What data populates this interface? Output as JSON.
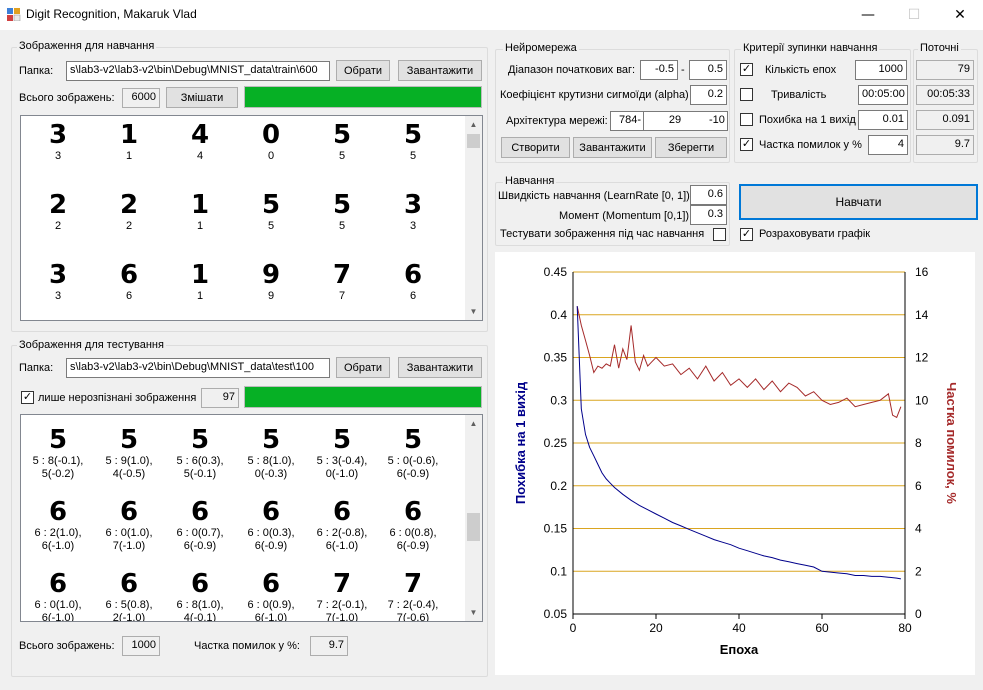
{
  "window": {
    "title": "Digit Recognition, Makaruk Vlad",
    "minimize": "—",
    "maximize": "☐",
    "close": "✕"
  },
  "train": {
    "group": "Зображення для навчання",
    "folder_label": "Папка:",
    "folder": "s\\lab3-v2\\lab3-v2\\bin\\Debug\\MNIST_data\\train\\600",
    "choose": "Обрати",
    "load": "Завантажити",
    "total_label": "Всього зображень:",
    "total": "6000",
    "shuffle": "Змішати",
    "progress": 1.0,
    "images": [
      {
        "d": "3",
        "l": "3"
      },
      {
        "d": "1",
        "l": "1"
      },
      {
        "d": "4",
        "l": "4"
      },
      {
        "d": "0",
        "l": "0"
      },
      {
        "d": "5",
        "l": "5"
      },
      {
        "d": "5",
        "l": "5"
      },
      {
        "d": "2",
        "l": "2"
      },
      {
        "d": "2",
        "l": "2"
      },
      {
        "d": "1",
        "l": "1"
      },
      {
        "d": "5",
        "l": "5"
      },
      {
        "d": "5",
        "l": "5"
      },
      {
        "d": "3",
        "l": "3"
      },
      {
        "d": "3",
        "l": "3"
      },
      {
        "d": "6",
        "l": "6"
      },
      {
        "d": "1",
        "l": "1"
      },
      {
        "d": "9",
        "l": "9"
      },
      {
        "d": "7",
        "l": "7"
      },
      {
        "d": "6",
        "l": "6"
      }
    ]
  },
  "test": {
    "group": "Зображення для тестування",
    "folder_label": "Папка:",
    "folder": "s\\lab3-v2\\lab3-v2\\bin\\Debug\\MNIST_data\\test\\100",
    "choose": "Обрати",
    "load": "Завантажити",
    "only_wrong_label": "лише нерозпізнані зображення",
    "only_wrong_checked": true,
    "wrong_count": "97",
    "progress": 1.0,
    "images": [
      {
        "d": "5",
        "l1": "5 : 8(-0.1),",
        "l2": "5(-0.2)"
      },
      {
        "d": "5",
        "l1": "5 : 9(1.0),",
        "l2": "4(-0.5)"
      },
      {
        "d": "5",
        "l1": "5 : 6(0.3),",
        "l2": "5(-0.1)"
      },
      {
        "d": "5",
        "l1": "5 : 8(1.0),",
        "l2": "0(-0.3)"
      },
      {
        "d": "5",
        "l1": "5 : 3(-0.4),",
        "l2": "0(-1.0)"
      },
      {
        "d": "5",
        "l1": "5 : 0(-0.6),",
        "l2": "6(-0.9)"
      },
      {
        "d": "6",
        "l1": "6 : 2(1.0),",
        "l2": "6(-1.0)"
      },
      {
        "d": "6",
        "l1": "6 : 0(1.0),",
        "l2": "7(-1.0)"
      },
      {
        "d": "6",
        "l1": "6 : 0(0.7),",
        "l2": "6(-0.9)"
      },
      {
        "d": "6",
        "l1": "6 : 0(0.3),",
        "l2": "6(-0.9)"
      },
      {
        "d": "6",
        "l1": "6 : 2(-0.8),",
        "l2": "6(-1.0)"
      },
      {
        "d": "6",
        "l1": "6 : 0(0.8),",
        "l2": "6(-0.9)"
      },
      {
        "d": "6",
        "l1": "6 : 0(1.0),",
        "l2": "6(-1.0)"
      },
      {
        "d": "6",
        "l1": "6 : 5(0.8),",
        "l2": "2(-1.0)"
      },
      {
        "d": "6",
        "l1": "6 : 8(1.0),",
        "l2": "4(-0.1)"
      },
      {
        "d": "6",
        "l1": "6 : 0(0.9),",
        "l2": "6(-1.0)"
      },
      {
        "d": "7",
        "l1": "7 : 2(-0.1),",
        "l2": "7(-1.0)"
      },
      {
        "d": "7",
        "l1": "7 : 2(-0.4),",
        "l2": "7(-0.6)"
      }
    ],
    "total_label": "Всього зображень:",
    "total": "1000",
    "error_label": "Частка помилок у %:",
    "error": "9.7"
  },
  "network": {
    "group": "Нейромережа",
    "weights_label": "Діапазон початкових ваг:",
    "w_min": "-0.5",
    "dash": "-",
    "w_max": "0.5",
    "alpha_label": "Коефіцієнт крутизни сигмоїди (alpha)",
    "alpha": "0.2",
    "arch_label": "Архітектура мережі:",
    "arch_in": "784-",
    "arch_hidden": "29",
    "arch_out": "-10",
    "create": "Створити",
    "load": "Завантажити",
    "save": "Зберегти"
  },
  "training": {
    "group": "Навчання",
    "lr_label": "Швидкість навчання (LearnRate [0, 1])",
    "lr": "0.6",
    "momentum_label": "Момент (Momentum [0,1])",
    "momentum": "0.3",
    "test_during_label": "Тестувати зображення під час навчання",
    "test_during_checked": false,
    "train_button": "Навчати",
    "calc_graph_label": "Розраховувати графік",
    "calc_graph_checked": true
  },
  "criteria": {
    "group": "Критерії зупинки навчання",
    "current_group": "Поточні",
    "epochs_label": "Кількість епох",
    "epochs_checked": true,
    "epochs": "1000",
    "epochs_cur": "79",
    "duration_label": "Тривалість",
    "duration_checked": false,
    "duration": "00:05:00",
    "duration_cur": "00:05:33",
    "err1_label": "Похибка на 1 вихід",
    "err1_checked": false,
    "err1": "0.01",
    "err1_cur": "0.091",
    "errpct_label": "Частка помилок у %",
    "errpct_checked": true,
    "errpct": "4",
    "errpct_cur": "9.7"
  },
  "chart_data": {
    "type": "line",
    "xlabel": "Епоха",
    "ylabel": "Похибка на 1 вихід",
    "y2label": "Частка помилок, %",
    "xlim": [
      0,
      80
    ],
    "ylim": [
      0.05,
      0.45
    ],
    "y2lim": [
      0,
      16
    ],
    "xticks": [
      "0",
      "20",
      "40",
      "60",
      "80"
    ],
    "yticks": [
      "0.05",
      "0.1",
      "0.15",
      "0.2",
      "0.25",
      "0.3",
      "0.35",
      "0.4",
      "0.45"
    ],
    "y2ticks": [
      "0",
      "2",
      "4",
      "6",
      "8",
      "10",
      "12",
      "14",
      "16"
    ],
    "grid": true,
    "colors": {
      "error": "#00008b",
      "rate": "#a52a2a",
      "grid": "#daa520"
    },
    "series": [
      {
        "name": "Похибка на 1 вихід",
        "axis": "left",
        "x": [
          1,
          2,
          3,
          4,
          5,
          6,
          7,
          8,
          9,
          10,
          12,
          14,
          16,
          18,
          20,
          22,
          24,
          26,
          28,
          30,
          32,
          34,
          36,
          38,
          40,
          42,
          44,
          46,
          48,
          50,
          52,
          54,
          56,
          58,
          60,
          62,
          64,
          66,
          68,
          70,
          72,
          74,
          76,
          78,
          79
        ],
        "values": [
          0.41,
          0.29,
          0.26,
          0.245,
          0.235,
          0.225,
          0.215,
          0.208,
          0.203,
          0.198,
          0.19,
          0.183,
          0.177,
          0.172,
          0.167,
          0.162,
          0.157,
          0.153,
          0.149,
          0.145,
          0.141,
          0.137,
          0.134,
          0.131,
          0.127,
          0.124,
          0.121,
          0.118,
          0.116,
          0.113,
          0.111,
          0.109,
          0.107,
          0.105,
          0.1,
          0.099,
          0.098,
          0.097,
          0.095,
          0.095,
          0.094,
          0.094,
          0.093,
          0.092,
          0.091
        ]
      },
      {
        "name": "Частка помилок, %",
        "axis": "right",
        "x": [
          1,
          2,
          3,
          4,
          5,
          6,
          7,
          8,
          9,
          10,
          11,
          12,
          13,
          14,
          15,
          16,
          17,
          18,
          19,
          20,
          22,
          24,
          26,
          28,
          30,
          32,
          34,
          36,
          38,
          40,
          42,
          44,
          46,
          48,
          50,
          52,
          54,
          56,
          58,
          60,
          62,
          64,
          66,
          68,
          70,
          72,
          74,
          76,
          77,
          78,
          79
        ],
        "values": [
          14.4,
          13.5,
          12.8,
          12.1,
          11.3,
          11.6,
          11.5,
          11.7,
          11.6,
          12.6,
          11.5,
          12.4,
          11.9,
          13.5,
          11.8,
          11.4,
          12.1,
          11.6,
          11.8,
          12.0,
          11.6,
          11.7,
          11.2,
          11.5,
          11.0,
          11.6,
          10.9,
          11.3,
          10.7,
          11.0,
          10.6,
          11.0,
          10.5,
          10.9,
          10.4,
          10.8,
          10.6,
          10.2,
          10.4,
          10.0,
          9.8,
          9.9,
          10.1,
          9.7,
          9.8,
          9.9,
          10.0,
          10.3,
          9.3,
          9.2,
          9.7
        ]
      }
    ]
  }
}
